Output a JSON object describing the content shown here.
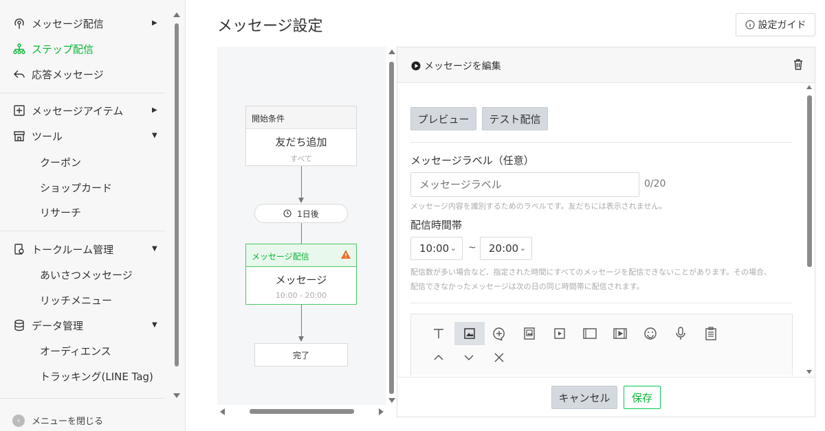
{
  "sidebar": {
    "items": [
      {
        "label": "メッセージ配信"
      },
      {
        "label": "ステップ配信"
      },
      {
        "label": "応答メッセージ"
      },
      {
        "label": "メッセージアイテム"
      },
      {
        "label": "ツール"
      },
      {
        "label": "トークルーム管理"
      },
      {
        "label": "データ管理"
      }
    ],
    "tools_sub": [
      "クーポン",
      "ショップカード",
      "リサーチ"
    ],
    "talkroom_sub": [
      "あいさつメッセージ",
      "リッチメニュー"
    ],
    "data_sub": [
      "オーディエンス",
      "トラッキング(LINE Tag)"
    ],
    "close_menu": "メニューを閉じる",
    "active_color": "#06b634"
  },
  "header": {
    "title": "メッセージ設定",
    "guide_button": "設定ガイド"
  },
  "flow": {
    "start_node": {
      "header": "開始条件",
      "title": "友だち追加",
      "sub": "すべて"
    },
    "delay": "1日後",
    "message_node": {
      "header": "メッセージ配信",
      "title": "メッセージ",
      "sub": "10:00 - 20:00"
    },
    "end": "完了"
  },
  "editor": {
    "title": "メッセージを編集",
    "preview_button": "プレビュー",
    "test_button": "テスト配信",
    "label_heading": "メッセージラベル（任意）",
    "label_placeholder": "メッセージラベル",
    "counter": "0/20",
    "label_hint": "メッセージ内容を識別するためのラベルです。友だちには表示されません。",
    "time_heading": "配信時間帯",
    "time_from": "10:00",
    "time_to": "20:00",
    "tilde": "~",
    "time_hint_1": "配信数が多い場合など、指定された時間にすべてのメッセージを配信できないことがあります。その場合、",
    "time_hint_2": "配信できなかったメッセージは次の日の同じ時間帯に配信されます。",
    "toolbar_icons": [
      "text-icon",
      "image-icon",
      "bubble-icon",
      "card-icon",
      "video-icon",
      "rich-message-icon",
      "rich-video-icon",
      "emoji-icon",
      "mic-icon",
      "survey-icon",
      "up-icon",
      "down-icon",
      "close-icon"
    ],
    "cancel_button": "キャンセル",
    "save_button": "保存"
  }
}
